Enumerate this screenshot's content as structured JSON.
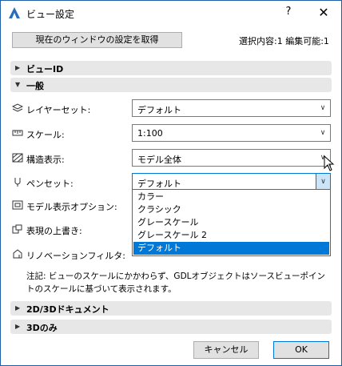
{
  "window": {
    "title": "ビュー設定",
    "help_glyph": "?",
    "close_glyph": "✕"
  },
  "top": {
    "get_settings_button": "現在のウィンドウの設定を取得",
    "selection_info": "選択内容:1 編集可能:1"
  },
  "sections": {
    "view_id": "ビューID",
    "general": "一般",
    "doc_2d3d": "2D/3Dドキュメント",
    "only_3d": "3Dのみ"
  },
  "rows": {
    "layer_set": {
      "label": "レイヤーセット:",
      "value": "デフォルト",
      "icon": "layers-icon"
    },
    "scale": {
      "label": "スケール:",
      "value": "1:100",
      "icon": "ruler-icon"
    },
    "structure": {
      "label": "構造表示:",
      "value": "モデル全体",
      "icon": "structure-icon"
    },
    "pen_set": {
      "label": "ペンセット:",
      "value": "デフォルト",
      "icon": "pen-icon"
    },
    "model_display": {
      "label": "モデル表示オプション:",
      "icon": "model-display-icon"
    },
    "override": {
      "label": "表現の上書き:",
      "icon": "override-icon"
    },
    "renovation": {
      "label": "リノベーションフィルタ:",
      "icon": "renovation-icon"
    }
  },
  "pen_set_options": [
    "カラー",
    "クラシック",
    "グレースケール",
    "グレースケール 2",
    "デフォルト"
  ],
  "pen_set_selected_index": 4,
  "note": "注記: ビューのスケールにかかわらず、GDLオブジェクトはソースビューポイントのスケールに基づいて表示されます。",
  "footer": {
    "cancel": "キャンセル",
    "ok": "OK"
  },
  "colors": {
    "accent": "#0078d7",
    "window_border": "#1f5fa8",
    "section_bg": "#e7e7e7"
  }
}
